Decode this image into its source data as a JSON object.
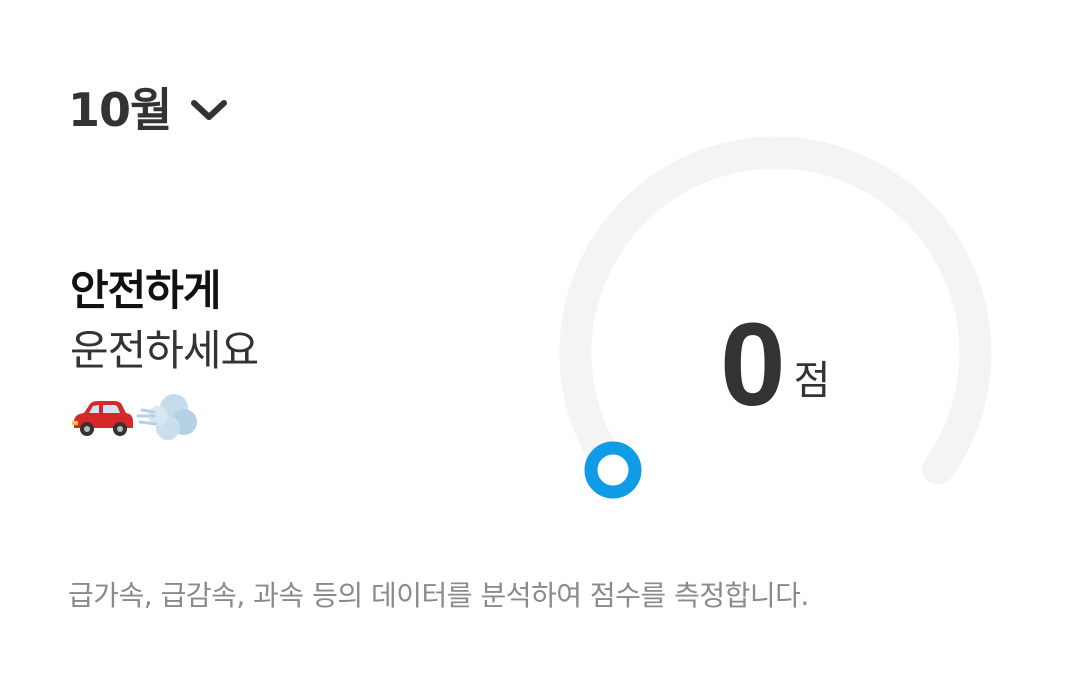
{
  "month_selector": {
    "label": "10월"
  },
  "headline": {
    "line1": "안전하게",
    "line2": "운전하세요"
  },
  "emoji": {
    "car": "red-car-icon",
    "dust": "dash-cloud-icon"
  },
  "score": {
    "value": "0",
    "unit": "점",
    "fraction": 0
  },
  "description": "급가속, 급감속, 과속 등의 데이터를 분석하여 점수를 측정합니다.",
  "colors": {
    "gauge_track": "#f4f4f4",
    "gauge_indicator": "#0f9be6",
    "text_primary": "#333333",
    "text_secondary": "#8a8a8a"
  }
}
